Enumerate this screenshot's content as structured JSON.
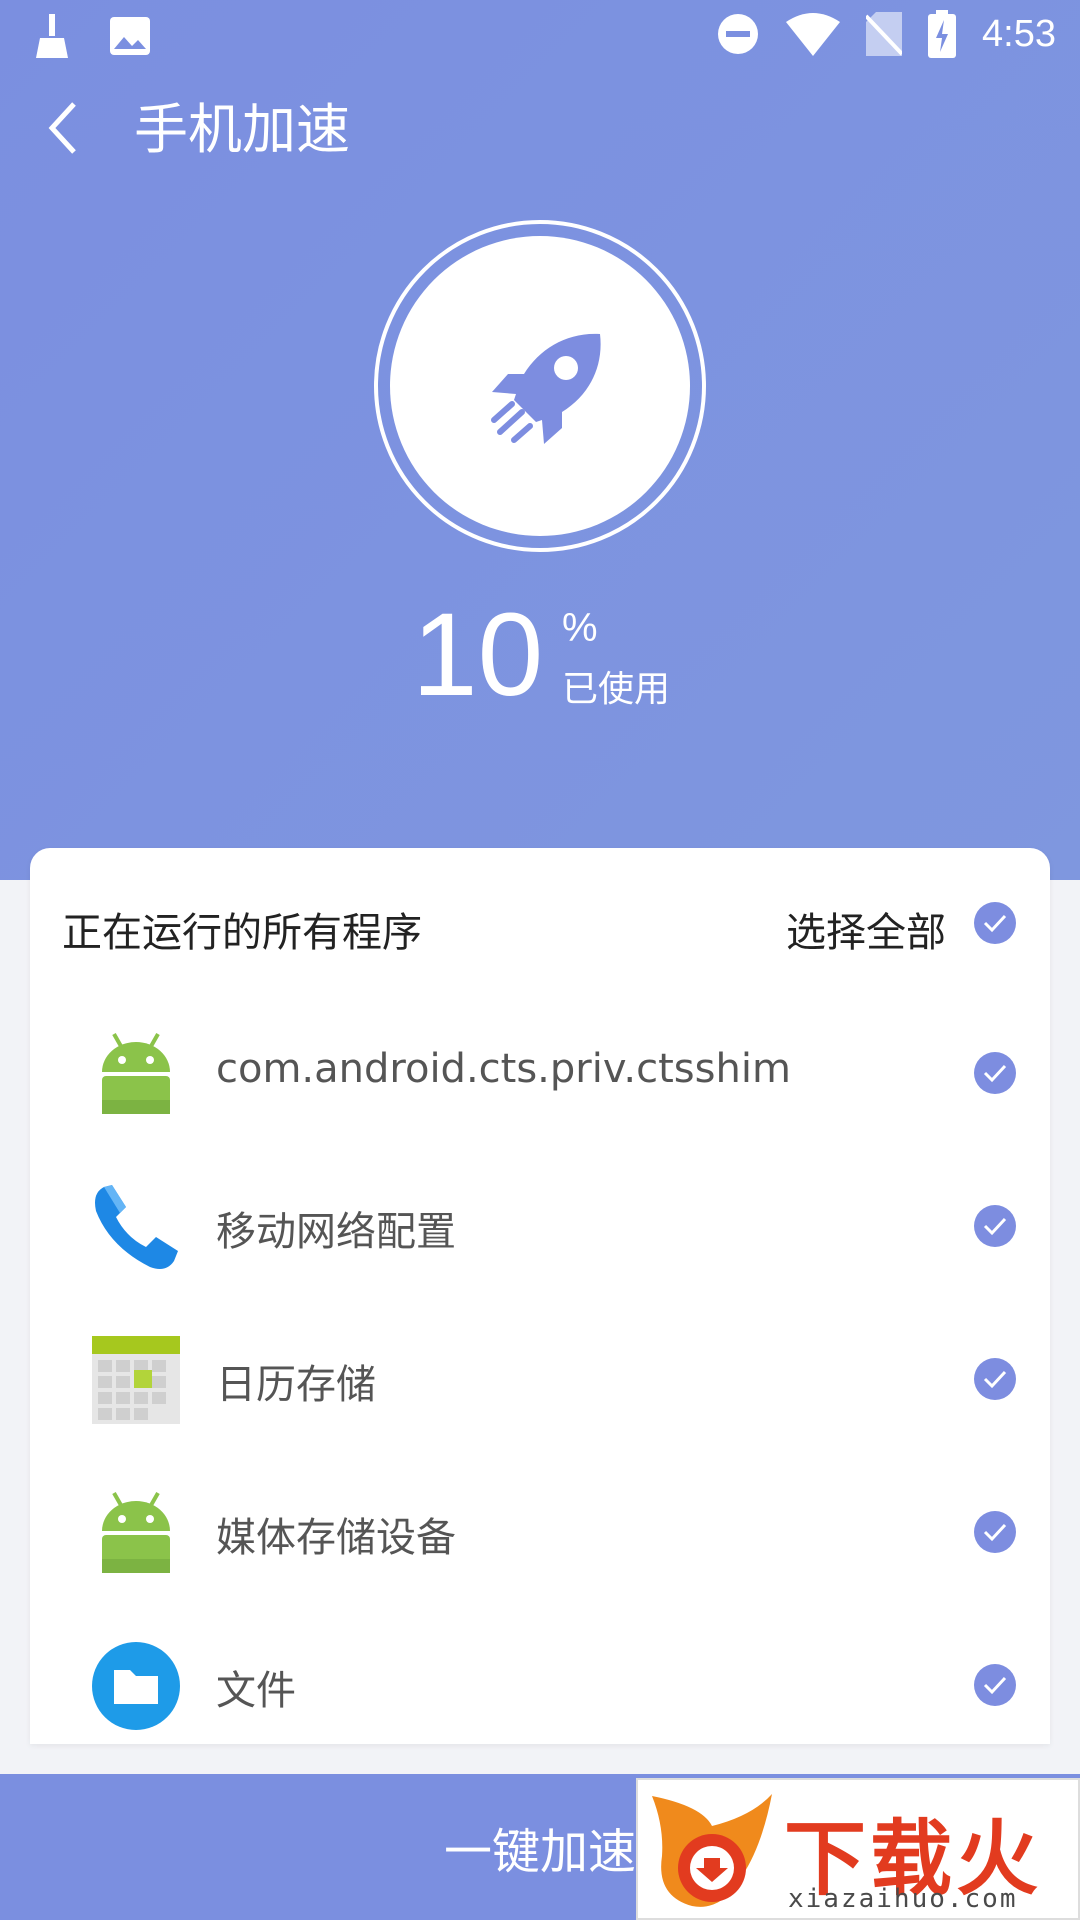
{
  "status_bar": {
    "time": "4:53",
    "left_icons": [
      "broom-icon",
      "image-icon"
    ],
    "right_icons": [
      "dnd-icon",
      "wifi-icon",
      "no-sim-icon",
      "battery-charging-icon"
    ]
  },
  "header": {
    "title": "手机加速",
    "back_icon": "chevron-left-icon"
  },
  "usage": {
    "value": "10",
    "unit": "%",
    "label": "已使用"
  },
  "list_header": {
    "title": "正在运行的所有程序",
    "select_all_label": "选择全部",
    "select_all_checked": true
  },
  "apps": [
    {
      "label": "com.android.cts.priv.ctsshim",
      "icon": "android-icon",
      "checked": true
    },
    {
      "label": "移动网络配置",
      "icon": "phone-icon",
      "checked": true
    },
    {
      "label": "日历存储",
      "icon": "calendar-icon",
      "checked": true
    },
    {
      "label": "媒体存储设备",
      "icon": "android-icon",
      "checked": true
    },
    {
      "label": "文件",
      "icon": "folder-icon",
      "checked": true
    }
  ],
  "bottom_button": {
    "label": "一键加速"
  },
  "watermark": {
    "text": "下载火",
    "sub": "xiazaihuo.com"
  },
  "colors": {
    "accent": "#7b8fe0",
    "check": "#7d8de0",
    "android_green": "#8bc34a",
    "phone_blue": "#1e88e5",
    "folder_blue": "#1e9be8",
    "watermark_red": "#e23b1f"
  }
}
